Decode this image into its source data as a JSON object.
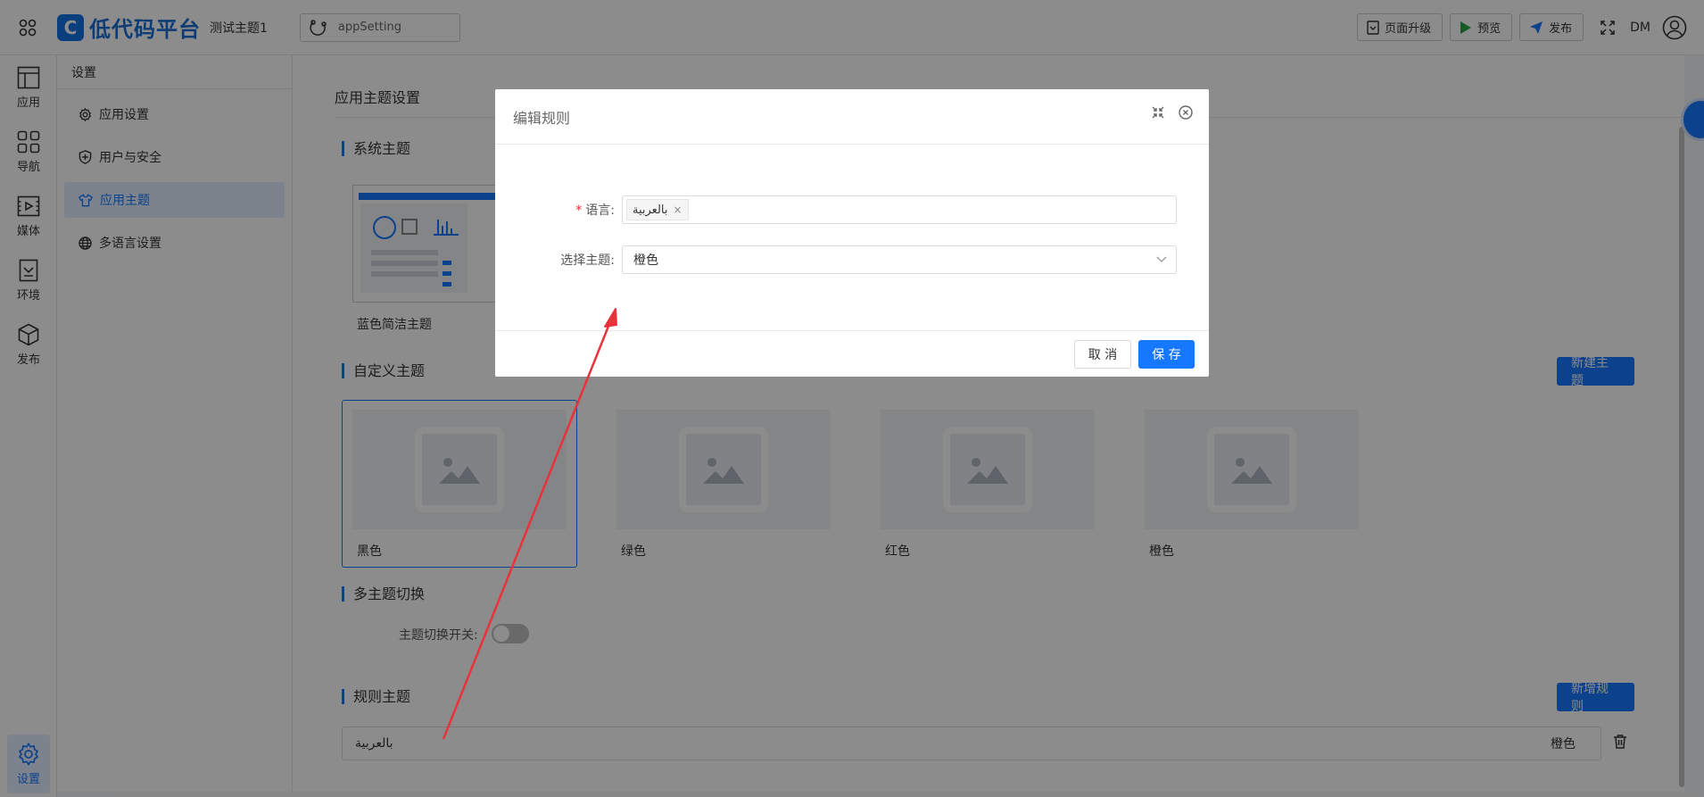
{
  "topbar": {
    "logo_mark": "C",
    "logo_text": "低代码平台",
    "app_name": "测试主题1",
    "page_select": "appSetting",
    "upgrade_label": "页面升级",
    "preview_label": "预览",
    "publish_label": "发布",
    "user_initials": "DM"
  },
  "rail": {
    "items": [
      {
        "label": "应用",
        "icon": "layout-icon"
      },
      {
        "label": "导航",
        "icon": "grid-icon"
      },
      {
        "label": "媒体",
        "icon": "media-icon"
      },
      {
        "label": "环境",
        "icon": "env-icon"
      },
      {
        "label": "发布",
        "icon": "cube-icon"
      }
    ],
    "active": {
      "label": "设置",
      "icon": "gear-icon"
    }
  },
  "subnav": {
    "title": "设置",
    "items": [
      {
        "label": "应用设置",
        "icon": "gear-icon"
      },
      {
        "label": "用户与安全",
        "icon": "shield-icon"
      },
      {
        "label": "应用主题",
        "icon": "shirt-icon",
        "active": true
      },
      {
        "label": "多语言设置",
        "icon": "globe-icon"
      }
    ]
  },
  "main": {
    "title": "应用主题设置",
    "system_section": "系统主题",
    "system_theme_label": "蓝色简洁主题",
    "custom_section": "自定义主题",
    "new_theme_button": "新建主题",
    "custom_themes": [
      "黑色",
      "绿色",
      "红色",
      "橙色"
    ],
    "switch_section": "多主题切换",
    "switch_label": "主题切换开关:",
    "switch_on": false,
    "rules_section": "规则主题",
    "new_rule_button": "新增规则",
    "rules": [
      {
        "language": "بالعربية",
        "theme": "橙色"
      }
    ]
  },
  "modal": {
    "title": "编辑规则",
    "language_label": "语言:",
    "language_tag": "بالعربية",
    "theme_label": "选择主题:",
    "theme_value": "橙色",
    "cancel_label": "取 消",
    "save_label": "保 存"
  },
  "colors": {
    "primary": "#1677ff",
    "arrow": "#e8323c",
    "required": "#f5222d"
  }
}
